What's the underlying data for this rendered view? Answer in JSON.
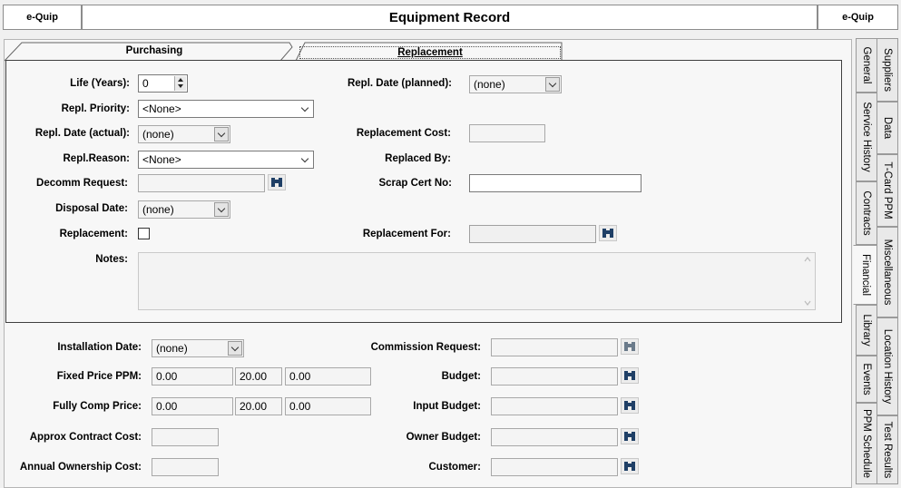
{
  "header": {
    "left_label": "e-Quip",
    "title": "Equipment Record",
    "right_label": "e-Quip"
  },
  "top_tabs": [
    {
      "label": "Purchasing",
      "active": false
    },
    {
      "label": "Replacement",
      "active": true
    }
  ],
  "replacement": {
    "life_years": {
      "label": "Life (Years):",
      "value": "0"
    },
    "repl_priority": {
      "label": "Repl. Priority:",
      "value": "<None>"
    },
    "repl_date_actual": {
      "label": "Repl. Date (actual):",
      "value": "(none)"
    },
    "repl_reason": {
      "label": "Repl.Reason:",
      "value": "<None>"
    },
    "decomm_request": {
      "label": "Decomm Request:",
      "value": ""
    },
    "disposal_date": {
      "label": "Disposal Date:",
      "value": "(none)"
    },
    "replacement": {
      "label": "Replacement:",
      "checked": false
    },
    "notes": {
      "label": "Notes:",
      "value": ""
    },
    "repl_date_planned": {
      "label": "Repl. Date (planned):",
      "value": "(none)"
    },
    "replacement_cost": {
      "label": "Replacement Cost:",
      "value": ""
    },
    "replaced_by": {
      "label": "Replaced By:"
    },
    "scrap_cert_no": {
      "label": "Scrap Cert  No:",
      "value": ""
    },
    "replacement_for": {
      "label": "Replacement For:",
      "value": ""
    }
  },
  "financial": {
    "installation_date": {
      "label": "Installation Date:",
      "value": "(none)"
    },
    "fixed_price_ppm": {
      "label": "Fixed Price PPM:",
      "values": [
        "0.00",
        "20.00",
        "0.00"
      ]
    },
    "fully_comp_price": {
      "label": "Fully Comp Price:",
      "values": [
        "0.00",
        "20.00",
        "0.00"
      ]
    },
    "approx_contract_cost": {
      "label": "Approx Contract Cost:",
      "value": ""
    },
    "annual_ownership_cost": {
      "label": "Annual Ownership Cost:",
      "value": ""
    },
    "commission_request": {
      "label": "Commission Request:",
      "value": ""
    },
    "budget": {
      "label": "Budget:",
      "value": ""
    },
    "input_budget": {
      "label": "Input Budget:",
      "value": ""
    },
    "owner_budget": {
      "label": "Owner Budget:",
      "value": ""
    },
    "customer": {
      "label": "Customer:",
      "value": ""
    }
  },
  "side_tabs_inner": [
    {
      "label": "General",
      "active": false
    },
    {
      "label": "Service History",
      "active": false
    },
    {
      "label": "Contracts",
      "active": false
    },
    {
      "label": "Financial",
      "active": true
    },
    {
      "label": "Library",
      "active": false
    },
    {
      "label": "Events",
      "active": false
    },
    {
      "label": "PPM Schedule",
      "active": false
    }
  ],
  "side_tabs_outer": [
    {
      "label": "Suppliers"
    },
    {
      "label": "Data"
    },
    {
      "label": "T-Card PPM"
    },
    {
      "label": "Miscellaneous"
    },
    {
      "label": "Location History"
    },
    {
      "label": "Test Results"
    }
  ],
  "colors": {
    "window_bg": "#f0f0f0",
    "panel_bg": "#f7f7f7",
    "border_dark": "#3f3f3f",
    "binoculars": "#1f3f66"
  },
  "icons": {
    "lookup": "binoculars-icon",
    "dropdown": "chevron-down-icon",
    "spinner": "spinner-arrows-icon"
  }
}
